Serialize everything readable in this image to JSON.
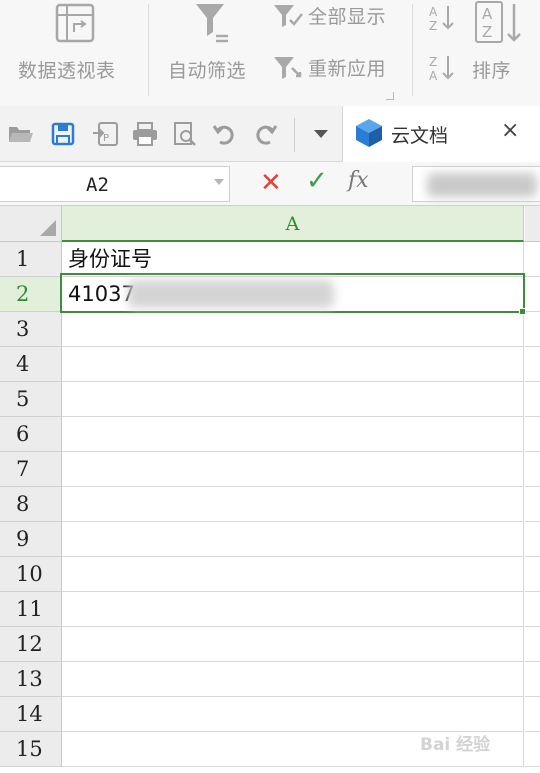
{
  "ribbon": {
    "pivot_label": "数据透视表",
    "autofilter_label": "自动筛选",
    "showall_label": "全部显示",
    "reapply_label": "重新应用",
    "sort_label": "排序"
  },
  "quick_access": {
    "icons": [
      "open-folder-icon",
      "save-icon",
      "export-icon",
      "print-icon",
      "print-preview-icon",
      "undo-icon",
      "redo-icon",
      "customize-dropdown-icon"
    ],
    "doc_tab_label": "云文档",
    "close_label": "×"
  },
  "formula_bar": {
    "name_box_value": "A2",
    "cancel_label": "✕",
    "confirm_label": "✓",
    "fx_label": "fx",
    "formula_value": ""
  },
  "grid": {
    "column_header": "A",
    "rows": [
      {
        "num": "1",
        "value": "身份证号"
      },
      {
        "num": "2",
        "value": "41037"
      },
      {
        "num": "3",
        "value": ""
      },
      {
        "num": "4",
        "value": ""
      },
      {
        "num": "5",
        "value": ""
      },
      {
        "num": "6",
        "value": ""
      },
      {
        "num": "7",
        "value": ""
      },
      {
        "num": "8",
        "value": ""
      },
      {
        "num": "9",
        "value": ""
      },
      {
        "num": "10",
        "value": ""
      },
      {
        "num": "11",
        "value": ""
      },
      {
        "num": "12",
        "value": ""
      },
      {
        "num": "13",
        "value": ""
      },
      {
        "num": "14",
        "value": ""
      },
      {
        "num": "15",
        "value": ""
      }
    ],
    "active_cell": "A2"
  },
  "watermark": {
    "text": "Bai 经验"
  },
  "colors": {
    "accent_green": "#3c8d3c",
    "selected_header_bg": "#e2efda",
    "cancel_red": "#e0443a",
    "confirm_green": "#3aa046",
    "cloud_blue": "#2b7cd3"
  }
}
